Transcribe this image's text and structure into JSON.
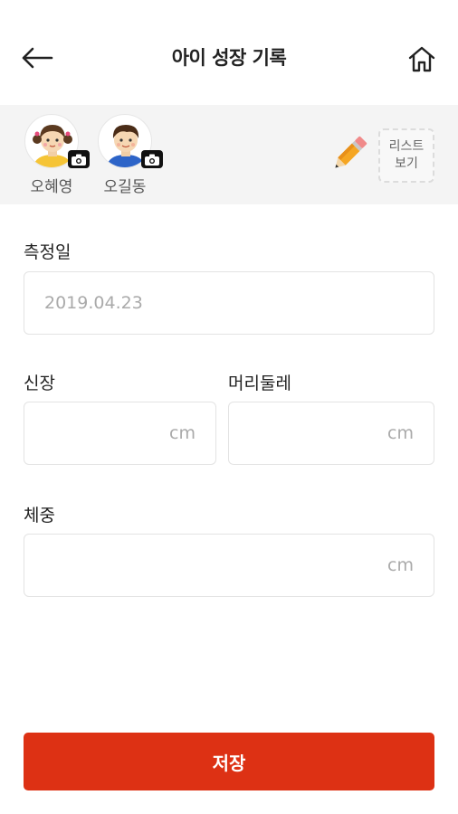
{
  "header": {
    "title": "아이 성장 기록",
    "back_icon": "arrow-left-icon",
    "home_icon": "home-icon"
  },
  "children": [
    {
      "name": "오혜영",
      "avatar": "girl-avatar",
      "camera_icon": "camera-icon"
    },
    {
      "name": "오길동",
      "avatar": "boy-avatar",
      "camera_icon": "camera-icon"
    }
  ],
  "toolbar": {
    "edit_icon": "pencil-icon",
    "list_view_line1": "리스트",
    "list_view_line2": "보기"
  },
  "form": {
    "date_label": "측정일",
    "date_value": "2019.04.23",
    "height_label": "신장",
    "height_unit": "cm",
    "head_label": "머리둘레",
    "head_unit": "cm",
    "weight_label": "체중",
    "weight_unit": "cm"
  },
  "actions": {
    "save_label": "저장"
  },
  "colors": {
    "accent": "#dd3114",
    "bar_background": "#f4f4f4"
  }
}
